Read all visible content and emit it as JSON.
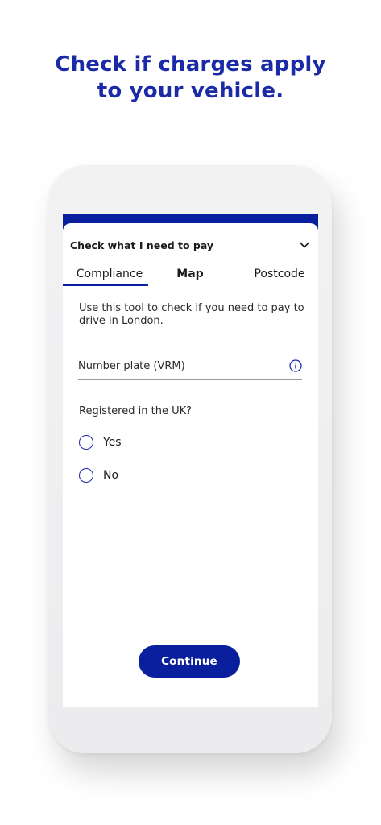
{
  "headline": {
    "line1": "Check if charges apply",
    "line2": "to your vehicle."
  },
  "sheet": {
    "title": "Check what I need to pay",
    "toggle_icon": "chevron-down-icon"
  },
  "tabs": [
    {
      "label": "Compliance",
      "selected": true
    },
    {
      "label": "Map",
      "selected": false
    },
    {
      "label": "Postcode",
      "selected": false
    }
  ],
  "form": {
    "intro": "Use this tool to check if you need to pay to drive in London.",
    "vrm_label": "Number plate (VRM)",
    "vrm_value": "",
    "info_icon": "info-icon",
    "question": "Registered in the UK?",
    "options": [
      {
        "label": "Yes",
        "checked": false
      },
      {
        "label": "No",
        "checked": false
      }
    ],
    "continue_label": "Continue"
  },
  "colors": {
    "brand_blue": "#0a1f9e",
    "headline_blue": "#1b2aa6"
  }
}
